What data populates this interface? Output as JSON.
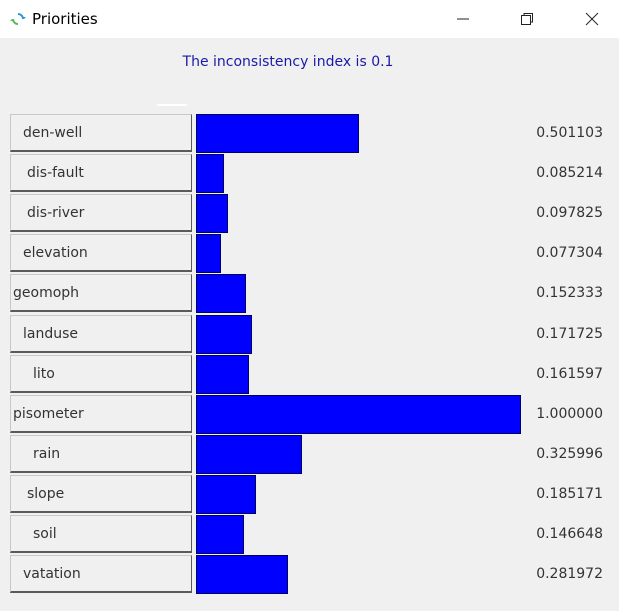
{
  "window": {
    "title": "Priorities",
    "icons": {
      "app": "refresh-arrows-icon",
      "minimize": "minimize-icon",
      "maximize": "maximize-icon",
      "close": "close-icon"
    }
  },
  "header": {
    "inconsistency_text": "The inconsistency index is 0.1"
  },
  "colors": {
    "bar": "#0000ff",
    "index_text": "#1a1aa8"
  },
  "rows": [
    {
      "label": "den-well",
      "value_text": "0.501103",
      "value": 0.501103
    },
    {
      "label": "dis-fault",
      "value_text": "0.085214",
      "value": 0.085214
    },
    {
      "label": "dis-river",
      "value_text": "0.097825",
      "value": 0.097825
    },
    {
      "label": "elevation",
      "value_text": "0.077304",
      "value": 0.077304
    },
    {
      "label": "geomoph",
      "value_text": "0.152333",
      "value": 0.152333
    },
    {
      "label": "landuse",
      "value_text": "0.171725",
      "value": 0.171725
    },
    {
      "label": "lito",
      "value_text": "0.161597",
      "value": 0.161597
    },
    {
      "label": "pisometer",
      "value_text": "1.000000",
      "value": 1.0
    },
    {
      "label": "rain",
      "value_text": "0.325996",
      "value": 0.325996
    },
    {
      "label": "slope",
      "value_text": "0.185171",
      "value": 0.185171
    },
    {
      "label": "soil",
      "value_text": "0.146648",
      "value": 0.146648
    },
    {
      "label": "vatation",
      "value_text": "0.281972",
      "value": 0.281972
    }
  ]
}
